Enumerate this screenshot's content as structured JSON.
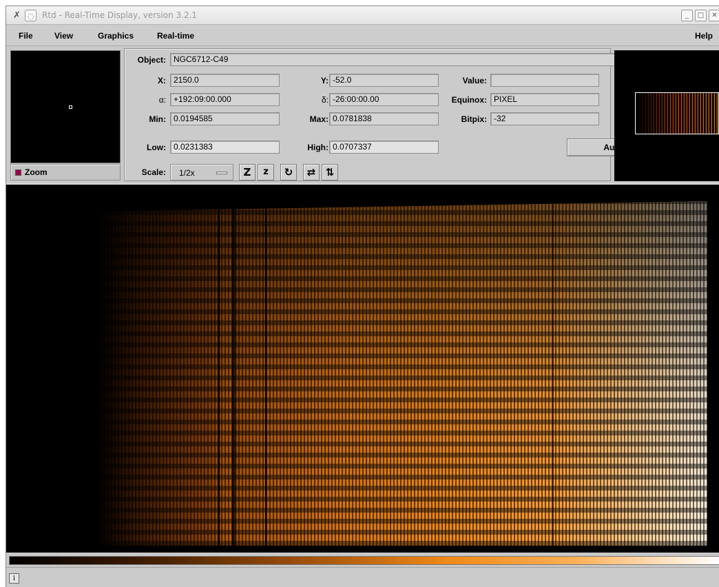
{
  "window": {
    "title": "Rtd - Real-Time Display, version 3.2.1",
    "controls": [
      "_",
      "□",
      "✕"
    ]
  },
  "menubar": {
    "file": "File",
    "view": "View",
    "graphics": "Graphics",
    "realtime": "Real-time",
    "help": "Help"
  },
  "zoom": {
    "label": "Zoom",
    "checked": true
  },
  "info": {
    "object_label": "Object:",
    "object": "NGC6712-C49",
    "x_label": "X:",
    "x": "2150.0",
    "y_label": "Y:",
    "y": "-52.0",
    "value_label": "Value:",
    "value": "",
    "alpha_label": "α:",
    "alpha": "+192:09:00.000",
    "delta_label": "δ:",
    "delta": "-26:00:00.00",
    "equinox_label": "Equinox:",
    "equinox": "PIXEL",
    "min_label": "Min:",
    "min": "0.0194585",
    "max_label": "Max:",
    "max": "0.0781838",
    "bitpix_label": "Bitpix:",
    "bitpix": "-32",
    "low_label": "Low:",
    "low": "0.0231383",
    "high_label": "High:",
    "high": "0.0707337",
    "auto_cut": "Auto Set Cut Levels",
    "scale_label": "Scale:",
    "scale": "1/2x"
  },
  "toolbar_icons": [
    {
      "name": "zoom-in-icon",
      "glyph": "Z"
    },
    {
      "name": "zoom-out-icon",
      "glyph": "z"
    },
    {
      "name": "rotate-icon",
      "glyph": "↻"
    },
    {
      "name": "flip-x-icon",
      "glyph": "⇄"
    },
    {
      "name": "flip-y-icon",
      "glyph": "⇅"
    }
  ],
  "status": {
    "info_icon": "i"
  },
  "colors": {
    "colormap": [
      "#000000",
      "#9a4c08",
      "#f08a18",
      "#ffffff"
    ],
    "zoom_check": "#a0004a"
  }
}
